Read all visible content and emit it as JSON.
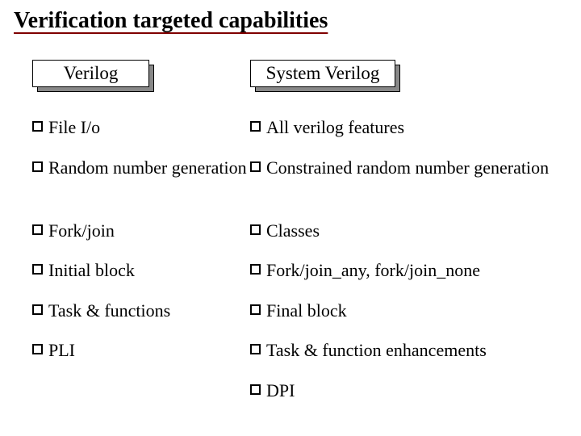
{
  "title": "Verification targeted capabilities",
  "columns": {
    "left": {
      "header": "Verilog",
      "items": [
        " File I/o",
        " Random number generation",
        " Fork/join",
        " Initial block",
        " Task & functions",
        " PLI"
      ]
    },
    "right": {
      "header": "System Verilog",
      "items": [
        "All verilog features",
        " Constrained random number generation",
        " Classes",
        " Fork/join_any, fork/join_none",
        " Final block",
        " Task & function enhancements",
        " DPI"
      ]
    }
  }
}
